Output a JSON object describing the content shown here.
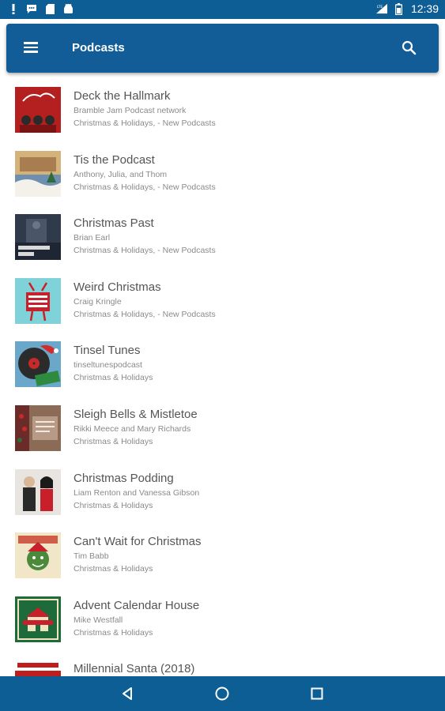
{
  "status_bar": {
    "time": "12:39",
    "left_icons": [
      "alert-icon",
      "chat-icon",
      "sd-card-icon",
      "android-icon"
    ],
    "right_icons": [
      "signal-icon",
      "battery-icon"
    ]
  },
  "app_bar": {
    "title": "Podcasts",
    "menu_icon": "menu-icon",
    "search_icon": "search-icon",
    "color": "#125d97"
  },
  "podcasts": [
    {
      "title": "Deck the Hallmark",
      "author": "Bramble Jam Podcast network",
      "category": "Christmas & Holidays, - New Podcasts",
      "thumb_color": "#b3201f"
    },
    {
      "title": "Tis the Podcast",
      "author": "Anthony, Julia, and Thom",
      "category": "Christmas & Holidays, - New Podcasts",
      "thumb_color": "#d4b37a"
    },
    {
      "title": "Christmas Past",
      "author": "Brian Earl",
      "category": "Christmas & Holidays, - New Podcasts",
      "thumb_color": "#2f3a4b"
    },
    {
      "title": "Weird Christmas",
      "author": "Craig Kringle",
      "category": "Christmas & Holidays, - New Podcasts",
      "thumb_color": "#7fd3d8"
    },
    {
      "title": "Tinsel Tunes",
      "author": "tinseltunespodcast",
      "category": "Christmas & Holidays",
      "thumb_color": "#6aa7c8"
    },
    {
      "title": "Sleigh Bells & Mistletoe",
      "author": "Rikki Meece and Mary Richards",
      "category": "Christmas & Holidays",
      "thumb_color": "#8b6b55"
    },
    {
      "title": "Christmas Podding",
      "author": "Liam Renton and Vanessa Gibson",
      "category": "Christmas & Holidays",
      "thumb_color": "#e8e4e0"
    },
    {
      "title": "Can't Wait for Christmas",
      "author": "Tim Babb",
      "category": "Christmas & Holidays",
      "thumb_color": "#f2e6c9"
    },
    {
      "title": "Advent Calendar House",
      "author": "Mike Westfall",
      "category": "Christmas & Holidays",
      "thumb_color": "#1d6b3a"
    },
    {
      "title": "Millennial Santa (2018)",
      "author": "",
      "category": "",
      "thumb_color": "#c01d1d"
    }
  ],
  "nav_bar": {
    "buttons": [
      "back-icon",
      "home-icon",
      "recents-icon"
    ]
  }
}
